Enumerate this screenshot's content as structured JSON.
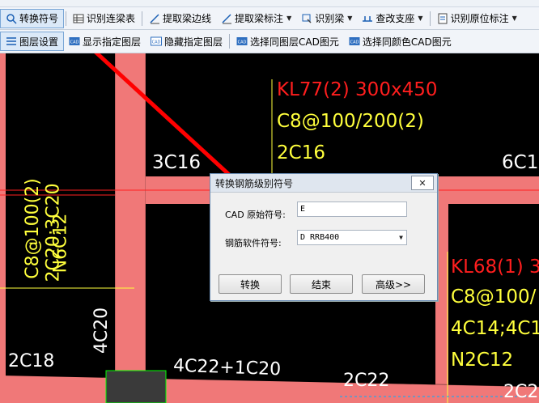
{
  "toolbar_row1": {
    "convert_symbol": "转换符号",
    "identify_beam_table": "识别连梁表",
    "extract_beam_edge": "提取梁边线",
    "extract_beam_label": "提取梁标注",
    "identify_beam": "识别梁",
    "check_support": "查改支座",
    "identify_in_situ_label": "识别原位标注"
  },
  "toolbar_row2": {
    "layer_settings": "图层设置",
    "show_layer": "显示指定图层",
    "hide_layer": "隐藏指定图层",
    "select_same_layer": "选择同图层CAD图元",
    "select_same_color": "选择同颜色CAD图元"
  },
  "cad_labels": {
    "kl77_name": "KL77(2) 300x450",
    "kl77_stirrup": "C8@100/200(2)",
    "kl77_top": "2C16",
    "left_3c16": "3C16",
    "right_6c1": "6C1",
    "vert_2c20_3c20": "2C20;3C20",
    "vert_n6c12": "N6C12",
    "vert_cut": "C8@100(2)",
    "kl68_name": "KL68(1) 3",
    "kl68_stirrup": "C8@100/",
    "kl68_bars": "4C14;4C1",
    "kl68_n": "N2C12",
    "col_4c20": "4C20",
    "bot_2c18": "2C18",
    "bot_4c22": "4C22+1C20",
    "bot_2c22": "2C22",
    "bot_2c2": "2C2"
  },
  "dialog": {
    "title": "转换钢筋级别符号",
    "close": "✕",
    "cad_symbol_label": "CAD 原始符号:",
    "cad_symbol_value": "E",
    "software_symbol_label": "钢筋软件符号:",
    "software_symbol_value": "D RRB400",
    "btn_convert": "转换",
    "btn_end": "结束",
    "btn_advanced": "高级>>"
  },
  "colors": {
    "beam_fill": "#f07878",
    "arrow": "#ff0000",
    "annotation_red": "#ff1e1e",
    "annotation_yellow": "#ffff3c"
  }
}
